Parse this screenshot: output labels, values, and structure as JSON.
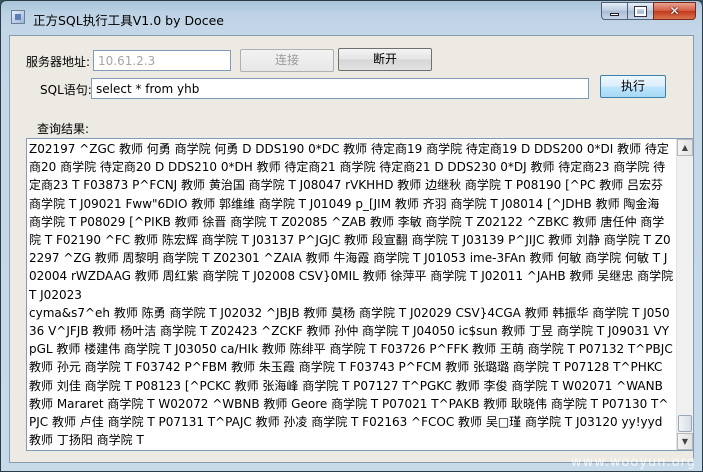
{
  "window": {
    "title": "正方SQL执行工具V1.0 by Docee"
  },
  "server": {
    "label": "服务器地址:",
    "value": "10.61.2.3",
    "connect_label": "连接",
    "disconnect_label": "断开"
  },
  "sql": {
    "label": "SQL语句:",
    "value": "select * from yhb",
    "execute_label": "执行"
  },
  "results": {
    "label": "查询结果:",
    "text": "Z02197 ^ZGC 教师 何勇 商学院 何勇 D DDS190 0*DC 教师 待定商19 商学院 待定商19 D DDS200 0*DI 教师 待定商20 商学院 待定商20 D DDS210 0*DH 教师 待定商21 商学院 待定商21 D DDS230 0*DJ 教师 待定商23 商学院 待定商23 T F03873 P^FCNJ 教师 黄治国 商学院 T J08047 rVKHHD 教师 边继秋 商学院 T P08190 [^PC 教师 吕宏芬 商学院 T J09021 Fww\"6DIO 教师 郭维维 商学院 T J01049 p_[JIM 教师 齐羽 商学院 T J08014 [^JDHB 教师 陶金海 商学院 T P08029 [^PIKB 教师 徐晋 商学院 T Z02085 ^ZAB 教师 李敏 商学院 T Z02122 ^ZBKC 教师 唐任仲 商学院 T F02190 ^FC 教师 陈宏辉 商学院 T J03137 P^JGJC 教师 段宣翻 商学院 T J03139 P^JIJC 教师 刘静 商学院 T Z02297 ^ZG 教师 周黎明 商学院 T Z02301 ^ZAIA 教师 牛海霞 商学院 T J01053 ime-3FAn 教师 何敏 商学院 何敏 T J02004 rWZDAAG 教师 周红紫 商学院 T J02008 CSV}0MIL 教师 徐萍平 商学院 T J02011 ^JAHB 教师 吴继忠 商学院 T J02023\ncyma&s7^eh 教师 陈勇 商学院 T J02032 ^JBJB 教师 莫杨 商学院 T J02029 CSV}4CGA 教师 韩振华 商学院 T J05036 V^JFJB 教师 杨叶洁 商学院 T Z02423 ^ZCKF 教师 孙仲 商学院 T J04050 ic$sun 教师 丁昱 商学院 T J09031 VYpGL 教师 楼建伟 商学院 T J03050 ca/HIk 教师 陈绯平 商学院 T F03726 P^FFK 教师 王萌 商学院 T P07132 T^PBJC 教师 孙元 商学院 T F03742 P^FBM 教师 朱玉霞 商学院 T F03743 P^FCM 教师 张璐璐 商学院 T P07128 T^PHKC 教师 刘佳 商学院 T P08123 [^PCKC 教师 张海峰 商学院 T P07127 T^PGKC 教师 李俊 商学院 T W02071 ^WANB 教师 Mararet 商学院 T W02072 ^WBNB 教师 Geore 商学院 T P07021 T^PAKB 教师 耿晓伟 商学院 T P07130 T^PJC 教师 卢佳 商学院 T P07131 T^PAJC 教师 孙凌 商学院 T F02163 ^FCOC 教师 吴□瑾 商学院 T J03120 yy!yyd 教师 丁扬阳 商学院 T"
  },
  "watermark": "www.wooyun.org"
}
